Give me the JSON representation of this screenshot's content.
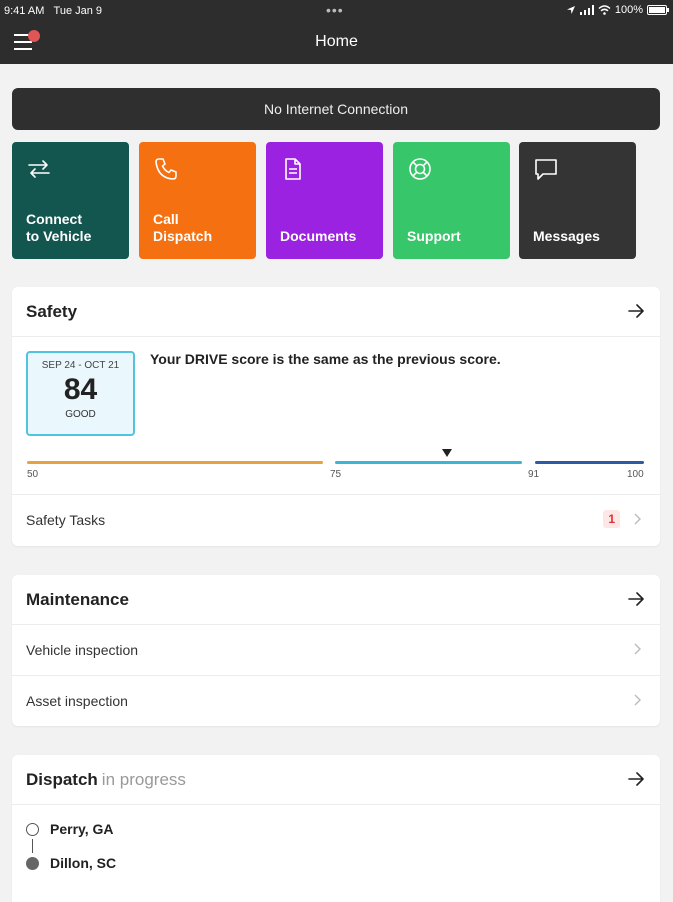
{
  "status": {
    "time": "9:41 AM",
    "date": "Tue Jan 9",
    "battery": "100%"
  },
  "nav": {
    "title": "Home"
  },
  "banner": {
    "text": "No Internet Connection"
  },
  "tiles": [
    {
      "label": "Connect\nto Vehicle",
      "color": "#13564f",
      "icon": "swap-arrows-icon"
    },
    {
      "label": "Call\nDispatch",
      "color": "#f47010",
      "icon": "phone-icon"
    },
    {
      "label": "Documents",
      "color": "#9a22e0",
      "icon": "document-icon"
    },
    {
      "label": "Support",
      "color": "#38c66a",
      "icon": "lifebuoy-icon"
    },
    {
      "label": "Messages",
      "color": "#343434",
      "icon": "message-icon"
    }
  ],
  "safety": {
    "title": "Safety",
    "period": "SEP 24 - OCT 21",
    "score": "84",
    "rating": "GOOD",
    "message": "Your DRIVE score is the same as the previous score.",
    "scale": {
      "min": "50",
      "t1": "75",
      "t2": "91",
      "max": "100"
    },
    "bar_colors": [
      "#e8a040",
      "#3bb5d6",
      "#2a5aa8"
    ],
    "tasks_label": "Safety Tasks",
    "tasks_count": "1"
  },
  "maintenance": {
    "title": "Maintenance",
    "items": [
      {
        "label": "Vehicle inspection"
      },
      {
        "label": "Asset inspection"
      }
    ]
  },
  "dispatch": {
    "title": "Dispatch",
    "status": "in progress",
    "stops": [
      {
        "name": "Perry, GA"
      },
      {
        "name": "Dillon, SC"
      }
    ]
  }
}
